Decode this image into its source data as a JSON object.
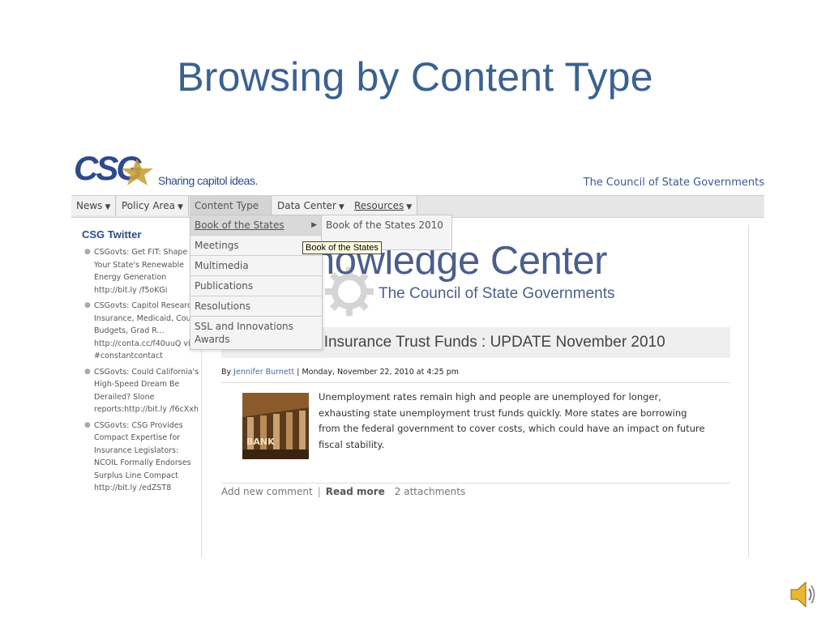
{
  "slide": {
    "title": "Browsing by Content Type"
  },
  "site": {
    "logo_text": "CSG",
    "tagline": "Sharing capitol ideas.",
    "org_name": "The Council of State Governments"
  },
  "nav": {
    "items": [
      {
        "label": "News",
        "arrow": "▼"
      },
      {
        "label": "Policy Area",
        "arrow": "▼"
      },
      {
        "label": "Content Type",
        "arrow": ""
      },
      {
        "label": "Data Center",
        "arrow": "▼"
      },
      {
        "label": "Resources",
        "arrow": "▼"
      }
    ]
  },
  "dropdown": {
    "items": [
      {
        "label": "Book of the States",
        "arrow": "▶"
      },
      {
        "label": "Meetings"
      },
      {
        "label": "Multimedia"
      },
      {
        "label": "Publications"
      },
      {
        "label": "Resolutions"
      },
      {
        "label": "SSL and Innovations Awards"
      }
    ],
    "submenu_item": "Book of the States 2010",
    "tooltip": "Book of the States"
  },
  "sidebar": {
    "heading": "CSG Twitter",
    "tweets": [
      "CSGovts: Get FIT: Shape up Your State's Renewable Energy Generation http://bit.ly /f5oKGi",
      "CSGovts: Capitol Research: Insurance, Medicaid, Court Budgets, Grad R... http://conta.cc/f40uuQ via #constantcontact",
      "CSGovts: Could California's High-Speed Dream Be Derailed? Slone reports:http://bit.ly /f6cXxh",
      "CSGovts: CSG Provides Compact Expertise for Insurance Legislators: NCOIL Formally Endorses Surplus Line Compact http://bit.ly /edZST8"
    ]
  },
  "main": {
    "kc_title": "nowledge Center",
    "kc_subtitle": "The Council of State Governments",
    "headline": "ent Insurance Trust Funds : UPDATE November 2010",
    "byline_prefix": "By",
    "author": "Jennifer Burnett",
    "byline_sep": "|",
    "date": "Monday, November 22, 2010 at 4:25 pm",
    "thumb_label": "BANK",
    "summary": "Unemployment rates remain high and people are unemployed for longer, exhausting state unemployment trust funds quickly. More states are borrowing from the federal government to cover costs, which could have an impact on future fiscal stability.",
    "links": {
      "add_comment": "Add new comment",
      "read_more": "Read more",
      "attachments": "2 attachments"
    }
  },
  "colors": {
    "title_blue": "#3b6191",
    "brand_blue": "#2f4a8a",
    "logo_gold": "#c9a23a"
  }
}
